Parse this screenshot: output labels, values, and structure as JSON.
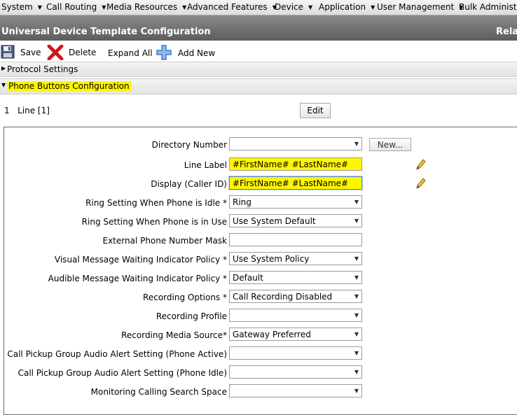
{
  "menu": [
    {
      "label": "System"
    },
    {
      "label": "Call Routing"
    },
    {
      "label": "Media Resources"
    },
    {
      "label": "Advanced Features"
    },
    {
      "label": "Device"
    },
    {
      "label": "Application"
    },
    {
      "label": "User Management"
    },
    {
      "label": "Bulk Administration"
    }
  ],
  "title": "Universal Device Template Configuration",
  "title_right": "Rela",
  "toolbar": {
    "save": "Save",
    "delete": "Delete",
    "expand_all": "Expand All",
    "add_new": "Add New"
  },
  "sections": {
    "protocol": "Protocol Settings",
    "phone_buttons": "Phone Buttons Configuration"
  },
  "line": {
    "label": "1   Line [1]",
    "edit": "Edit"
  },
  "form": {
    "directory_number": {
      "label": "Directory Number",
      "value": "",
      "new_button": "New..."
    },
    "line_label": {
      "label": "Line Label",
      "value": "#FirstName# #LastName#"
    },
    "display": {
      "label": "Display (Caller ID)",
      "value": "#FirstName# #LastName#"
    },
    "ring_idle": {
      "label": "Ring Setting When Phone is Idle *",
      "value": "Ring"
    },
    "ring_in_use": {
      "label": "Ring Setting When Phone is in Use",
      "value": "Use System Default"
    },
    "external_mask": {
      "label": "External Phone Number Mask",
      "value": ""
    },
    "visual_mwi": {
      "label": "Visual Message Waiting Indicator Policy *",
      "value": "Use System Policy"
    },
    "audible_mwi": {
      "label": "Audible Message Waiting Indicator Policy *",
      "value": "Default"
    },
    "recording_options": {
      "label": "Recording Options *",
      "value": "Call Recording Disabled"
    },
    "recording_profile": {
      "label": "Recording Profile",
      "value": ""
    },
    "recording_media": {
      "label": "Recording Media Source*",
      "value": "Gateway Preferred"
    },
    "pickup_active": {
      "label": "Call Pickup Group Audio Alert Setting (Phone Active)",
      "value": ""
    },
    "pickup_idle": {
      "label": "Call Pickup Group Audio Alert Setting (Phone Idle)",
      "value": ""
    },
    "monitoring_css": {
      "label": "Monitoring Calling Search Space",
      "value": ""
    }
  },
  "colors": {
    "highlight": "#fff600",
    "title_bar": "#6e6e6e",
    "delete_red": "#d0151a",
    "add_blue": "#3d7fd1"
  }
}
